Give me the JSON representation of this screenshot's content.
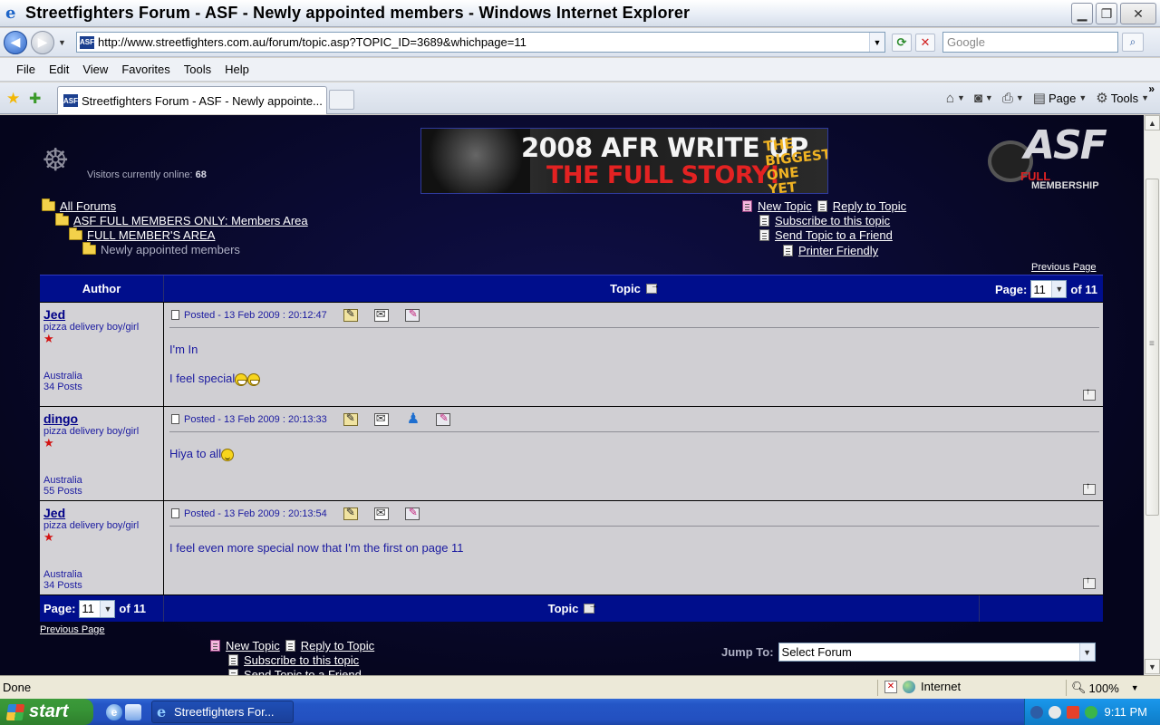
{
  "window": {
    "title": "Streetfighters Forum - ASF - Newly appointed members - Windows Internet Explorer"
  },
  "address": {
    "url": "http://www.streetfighters.com.au/forum/topic.asp?TOPIC_ID=3689&whichpage=11",
    "search_placeholder": "Google"
  },
  "menu": [
    "File",
    "Edit",
    "View",
    "Favorites",
    "Tools",
    "Help"
  ],
  "tab": {
    "label": "Streetfighters Forum - ASF - Newly appointe..."
  },
  "command_bar": {
    "page_label": "Page",
    "tools_label": "Tools"
  },
  "header": {
    "visitors_label": "Visitors currently online:",
    "visitors_count": "68",
    "banner": {
      "line1": "2008 AFR WRITE UP",
      "line2": "THE FULL STORY!",
      "tagline": "THE BIGGEST ONE YET"
    },
    "logo": {
      "text": "ASF",
      "full": "FULL",
      "membership": "MEMBERSHIP"
    }
  },
  "breadcrumb": [
    "All Forums",
    "ASF FULL MEMBERS ONLY: Members Area",
    "FULL MEMBER'S AREA",
    "Newly appointed members"
  ],
  "actions": {
    "new_topic": "New Topic",
    "reply": "Reply to Topic",
    "subscribe": "Subscribe to this topic",
    "send": "Send Topic to a Friend",
    "printer": "Printer Friendly"
  },
  "pagination": {
    "previous": "Previous Page",
    "page_label": "Page:",
    "current": "11",
    "of_label": "of 11"
  },
  "table": {
    "author_header": "Author",
    "topic_header": "Topic"
  },
  "posts": [
    {
      "author": "Jed",
      "rank": "pizza delivery boy/girl",
      "country": "Australia",
      "post_count": "34 Posts",
      "posted": "Posted - 13 Feb 2009 :  20:12:47",
      "body_line1": "I'm In",
      "body_line2": "I feel special"
    },
    {
      "author": "dingo",
      "rank": "pizza delivery boy/girl",
      "country": "Australia",
      "post_count": "55 Posts",
      "posted": "Posted - 13 Feb 2009 :  20:13:33",
      "body_line1": "Hiya to all"
    },
    {
      "author": "Jed",
      "rank": "pizza delivery boy/girl",
      "country": "Australia",
      "post_count": "34 Posts",
      "posted": "Posted - 13 Feb 2009 :  20:13:54",
      "body_line1": "I feel even more special now that I'm the first on page 11"
    }
  ],
  "jump": {
    "label": "Jump To:",
    "selected": "Select Forum"
  },
  "status": {
    "text": "Done",
    "zone": "Internet",
    "zoom": "100%"
  },
  "taskbar": {
    "start": "start",
    "task": "Streetfighters For...",
    "clock": "9:11 PM"
  }
}
